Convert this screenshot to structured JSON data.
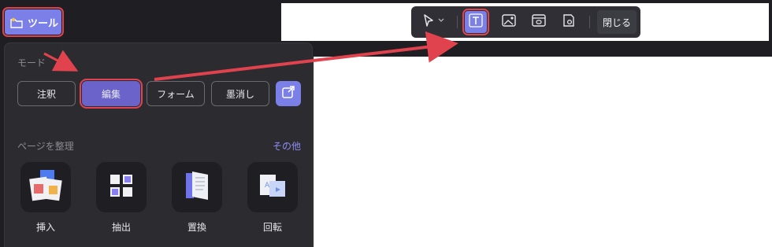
{
  "toolbar": {
    "tools_label": "ツール",
    "close_label": "閉じる"
  },
  "panel": {
    "mode_label": "モード",
    "modes": [
      "注釈",
      "編集",
      "フォーム",
      "墨消し"
    ],
    "organize_label": "ページを整理",
    "more_label": "その他",
    "tiles": [
      "挿入",
      "抽出",
      "置換",
      "回転"
    ]
  },
  "icons": {
    "tools": "folder-icon",
    "external": "external-link-icon",
    "select": "cursor-icon",
    "text": "text-icon",
    "image": "image-icon",
    "link": "link-icon",
    "sign": "location-icon"
  },
  "colors": {
    "accent": "#7b7fe8",
    "active_mode": "#6b63c9",
    "highlight": "#e0434d",
    "panel_bg": "#2b2b30",
    "link": "#8f8cf5"
  }
}
